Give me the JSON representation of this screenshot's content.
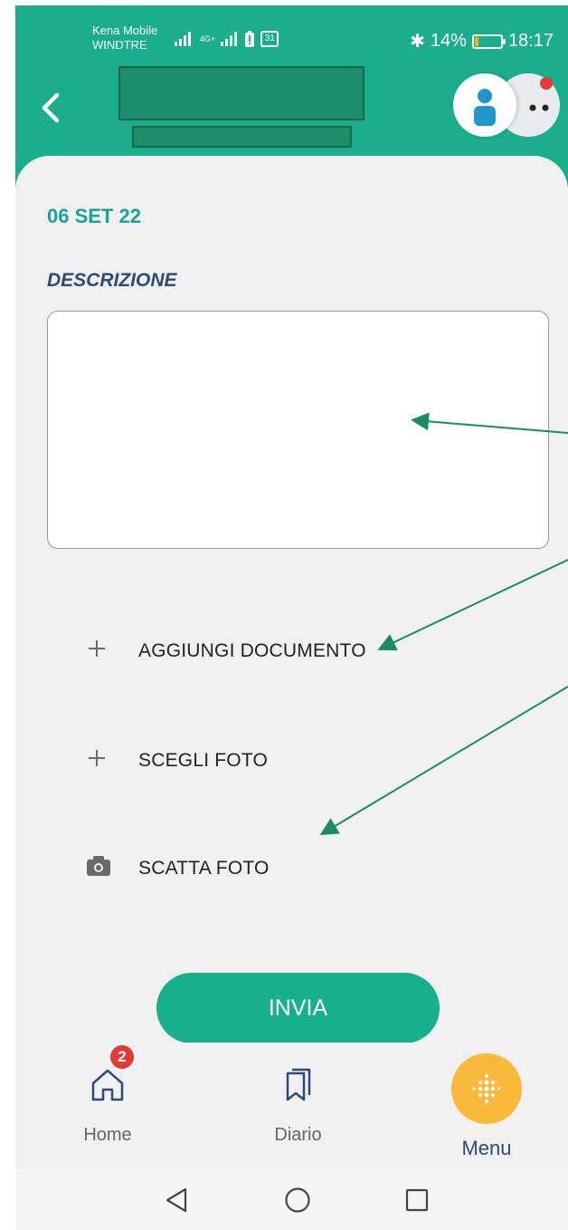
{
  "status_bar": {
    "carrier_1": "Kena Mobile",
    "carrier_2": "WINDTRE",
    "network": "4G+",
    "calendar_day": "31",
    "battery_percent": "14%",
    "battery_level": 0.14,
    "time": "18:17"
  },
  "header": {
    "back_icon": "chevron-left-icon",
    "avatar_icon": "user-icon",
    "more_icon": "more-dots-icon"
  },
  "form": {
    "date": "06 SET 22",
    "description_label": "DESCRIZIONE",
    "description_value": ""
  },
  "actions": [
    {
      "icon": "plus-icon",
      "label": "AGGIUNGI DOCUMENTO"
    },
    {
      "icon": "plus-icon",
      "label": "SCEGLI FOTO"
    },
    {
      "icon": "camera-icon",
      "label": "SCATTA FOTO"
    }
  ],
  "send_button": "INVIA",
  "bottom_nav": {
    "home": {
      "label": "Home",
      "badge": "2",
      "icon": "home-icon"
    },
    "diario": {
      "label": "Diario",
      "icon": "bookmark-icon"
    },
    "menu": {
      "label": "Menu",
      "icon": "menu-dots-icon"
    }
  },
  "colors": {
    "primary": "#1aae8c",
    "accent": "#f9b93a",
    "date": "#1aa39a",
    "label": "#2c4a7a",
    "badge": "#e53935"
  }
}
